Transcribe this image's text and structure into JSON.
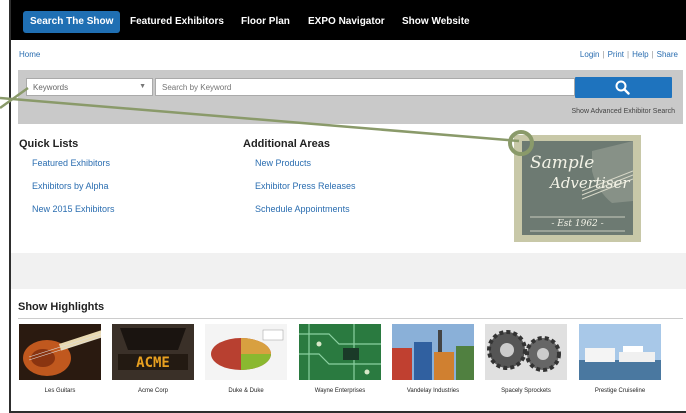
{
  "topnav": {
    "items": [
      {
        "label": "Search The Show",
        "active": true
      },
      {
        "label": "Featured Exhibitors",
        "active": false
      },
      {
        "label": "Floor Plan",
        "active": false
      },
      {
        "label": "EXPO Navigator",
        "active": false
      },
      {
        "label": "Show Website",
        "active": false
      }
    ]
  },
  "breadcrumb": {
    "home": "Home"
  },
  "util_links": {
    "login": "Login",
    "print": "Print",
    "help": "Help",
    "share": "Share"
  },
  "search": {
    "scope_selected": "Keywords",
    "placeholder": "Search by Keyword",
    "button_icon": "search-icon",
    "advanced_link": "Show Advanced Exhibitor Search"
  },
  "quick_lists": {
    "title": "Quick Lists",
    "links": [
      "Featured Exhibitors",
      "Exhibitors by Alpha",
      "New 2015 Exhibitors"
    ]
  },
  "additional_areas": {
    "title": "Additional Areas",
    "links": [
      "New Products",
      "Exhibitor Press Releases",
      "Schedule Appointments"
    ]
  },
  "ad": {
    "line1": "Sample",
    "line2": "Advertiser",
    "est": "- Est 1962 -"
  },
  "highlights": {
    "title": "Show Highlights",
    "items": [
      {
        "label": "Les Guitars",
        "thumb": "guitar"
      },
      {
        "label": "Acme Corp",
        "thumb": "acme"
      },
      {
        "label": "Duke & Duke",
        "thumb": "pie"
      },
      {
        "label": "Wayne Enterprises",
        "thumb": "circuit"
      },
      {
        "label": "Vandelay Industries",
        "thumb": "containers"
      },
      {
        "label": "Spacely Sprockets",
        "thumb": "gears"
      },
      {
        "label": "Prestige Cruiseline",
        "thumb": "ships"
      }
    ]
  },
  "colors": {
    "nav_bg": "#000000",
    "accent": "#1e73be",
    "link": "#2a6db0",
    "pointer": "#8a9a6a"
  }
}
